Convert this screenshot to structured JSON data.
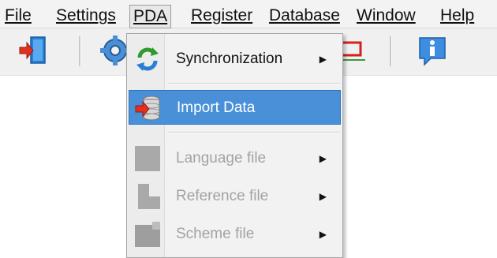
{
  "menubar": {
    "items": [
      {
        "label": "File"
      },
      {
        "label": "Settings"
      },
      {
        "label": "PDA"
      },
      {
        "label": "Register"
      },
      {
        "label": "Database"
      },
      {
        "label": "Window"
      },
      {
        "label": "Help"
      }
    ]
  },
  "toolbar": {
    "buttons": [
      {
        "icon": "exit-door-icon"
      },
      {
        "icon": "gear-icon"
      },
      {
        "icon": "network-icon"
      },
      {
        "icon": "info-icon"
      }
    ]
  },
  "pda_menu": {
    "items": [
      {
        "label": "Synchronization",
        "icon": "sync-icon",
        "has_submenu": true,
        "enabled": true
      },
      {
        "label": "Import Data",
        "icon": "database-import-icon",
        "has_submenu": false,
        "enabled": true,
        "highlighted": true
      },
      {
        "label": "Language file",
        "icon": "language-file-icon",
        "has_submenu": true,
        "enabled": false
      },
      {
        "label": "Reference file",
        "icon": "reference-file-icon",
        "has_submenu": true,
        "enabled": false
      },
      {
        "label": "Scheme file",
        "icon": "scheme-file-icon",
        "has_submenu": true,
        "enabled": false
      }
    ],
    "submenu_arrow": "▶"
  },
  "colors": {
    "highlight": "#4a90d9",
    "disabled_text": "#a3a3a3",
    "menu_bg": "#f2f2f2"
  }
}
